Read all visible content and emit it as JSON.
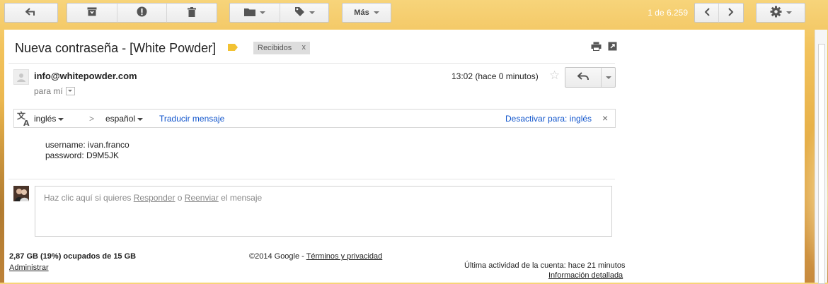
{
  "toolbar": {
    "more_label": "Más",
    "pager_text": "1 de 6.259"
  },
  "message": {
    "subject": "Nueva contraseña - [White Powder]",
    "label_chip": "Recibidos",
    "label_chip_remove": "x",
    "sender": "info@whitepowder.com",
    "recipient": "para mí",
    "time": "13:02 (hace 0 minutos)",
    "star": "☆",
    "body_line1": "username: ivan.franco",
    "body_line2": "password: D9M5JK"
  },
  "translate": {
    "source_lang": "inglés",
    "arrow": ">",
    "target_lang": "español",
    "translate_link": "Traducir mensaje",
    "disable_link": "Desactivar para: inglés",
    "close": "×"
  },
  "reply": {
    "prefix": "Haz clic aquí si quieres ",
    "reply_link": "Responder",
    "middle": " o ",
    "forward_link": "Reenviar",
    "suffix": " el mensaje"
  },
  "footer": {
    "storage": "2,87 GB (19%) ocupados de 15 GB",
    "manage": "Administrar",
    "copyright": "©2014 Google - ",
    "terms": "Términos y privacidad",
    "activity": "Última actividad de la cuenta: hace 21 minutos",
    "details": "Información detallada"
  },
  "colors": {
    "link": "#1155cc",
    "label_yellow": "#f2c233",
    "background_gold": "#e8b24a"
  },
  "icons": [
    "back-arrow-icon",
    "archive-icon",
    "report-spam-icon",
    "delete-icon",
    "folder-icon",
    "label-icon",
    "chevron-left-icon",
    "chevron-right-icon",
    "gear-icon",
    "print-icon",
    "new-window-icon",
    "reply-icon",
    "translate-icon"
  ]
}
